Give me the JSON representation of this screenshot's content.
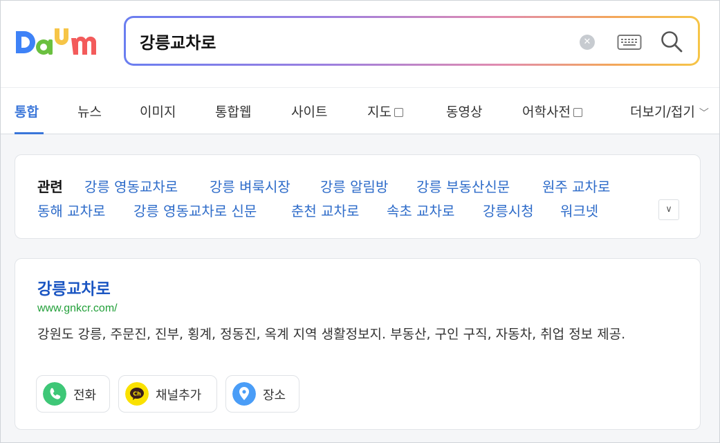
{
  "header": {
    "logo_text": "Daum",
    "search": {
      "query": "강릉교차로"
    }
  },
  "tabs": [
    {
      "label": "통합",
      "active": true
    },
    {
      "label": "뉴스"
    },
    {
      "label": "이미지"
    },
    {
      "label": "통합웹"
    },
    {
      "label": "사이트"
    },
    {
      "label": "지도",
      "external": true
    },
    {
      "label": "동영상"
    },
    {
      "label": "어학사전",
      "external": true
    },
    {
      "label": "더보기/접기"
    }
  ],
  "related": {
    "title": "관련",
    "links": [
      "강릉 영동교차로",
      "강릉 벼룩시장",
      "강릉 알림방",
      "강릉 부동산신문",
      "원주 교차로",
      "동해 교차로",
      "강릉 영동교차로 신문",
      "춘천 교차로",
      "속초 교차로",
      "강릉시청",
      "워크넷"
    ]
  },
  "result": {
    "title": "강릉교차로",
    "url": "www.gnkcr.com/",
    "description": "강원도 강릉, 주문진, 진부, 횡계, 정동진, 옥계 지역 생활정보지. 부동산, 구인 구직, 자동차, 취업 정보 제공.",
    "actions": [
      {
        "label": "전화",
        "icon": "phone-icon"
      },
      {
        "label": "채널추가",
        "icon": "kakao-channel-icon",
        "icon_text": "Ch"
      },
      {
        "label": "장소",
        "icon": "map-pin-icon"
      }
    ]
  },
  "colors": {
    "accent": "#3a76d9",
    "link": "#2d6bc9",
    "title": "#1a55c2",
    "url": "#23a03a"
  }
}
